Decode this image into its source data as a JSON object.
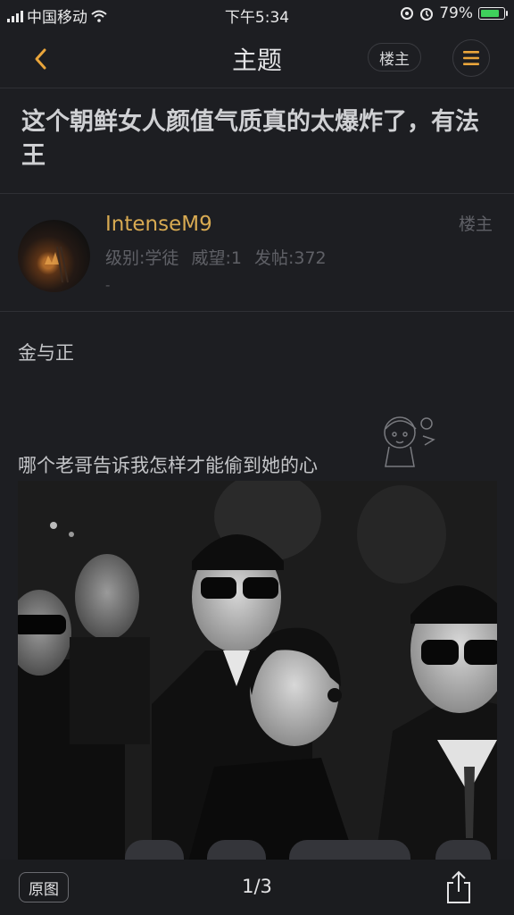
{
  "status_bar": {
    "carrier": "中国移动",
    "time": "下午5:34",
    "battery": "79%"
  },
  "navbar": {
    "title": "主题",
    "op_filter_label": "楼主"
  },
  "post": {
    "title": "这个朝鲜女人颜值气质真的太爆炸了，有法王",
    "author": {
      "username": "IntenseM9",
      "stats": "级别:学徒  威望:1  发帖:372",
      "signature": "-",
      "floor_label": "楼主"
    },
    "paragraphs": [
      "金与正",
      "哪个老哥告诉我怎样才能偷到她的心"
    ]
  },
  "image_viewer": {
    "original_label": "原图",
    "page_indicator": "1/3"
  },
  "icons": {
    "back": "chevron-left-icon",
    "menu": "menu-icon",
    "share": "share-icon"
  },
  "colors": {
    "accent": "#e9a53b",
    "username": "#d8aa52",
    "background": "#1d1e22"
  }
}
